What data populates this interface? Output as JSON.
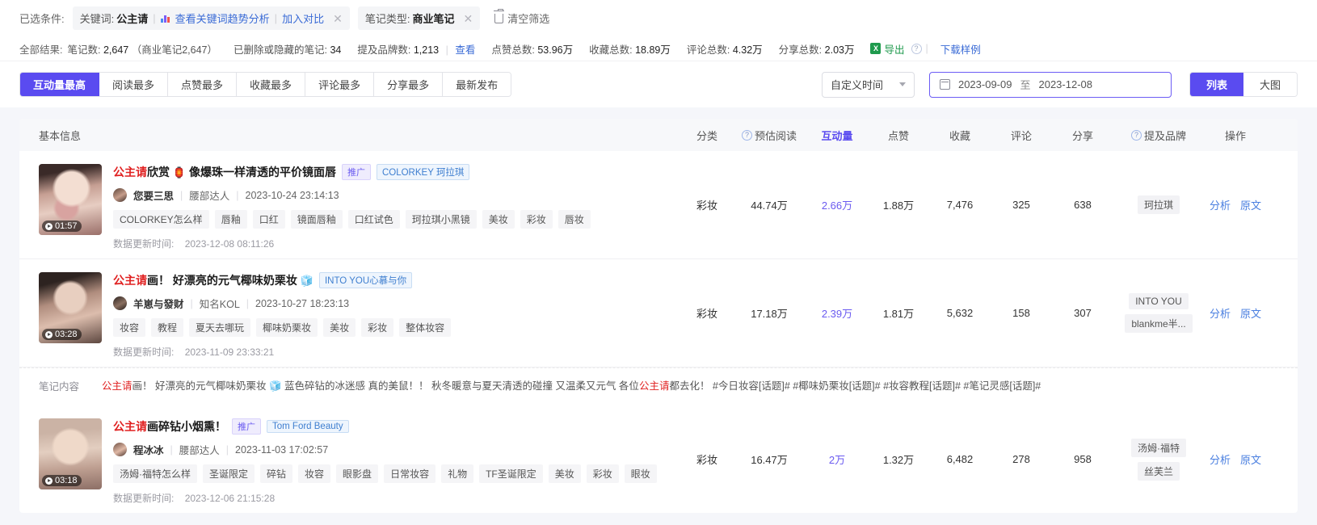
{
  "filters": {
    "label": "已选条件:",
    "chips": [
      {
        "key": "关键词:",
        "value": "公主请",
        "link1": "查看关键词趋势分析",
        "link2": "加入对比",
        "has_chart_icon": true,
        "closable": true
      },
      {
        "key": "笔记类型:",
        "value": "商业笔记",
        "closable": true
      }
    ],
    "clear_label": "清空筛选"
  },
  "stats": {
    "lead": "全部结果:",
    "items": [
      {
        "label": "笔记数:",
        "value": "2,647",
        "extra": "（商业笔记2,647）"
      },
      {
        "label": "已删除或隐藏的笔记:",
        "value": "34"
      },
      {
        "label": "提及品牌数:",
        "value": "1,213",
        "link": "查看"
      },
      {
        "label": "点赞总数:",
        "value": "53.96万"
      },
      {
        "label": "收藏总数:",
        "value": "18.89万"
      },
      {
        "label": "评论总数:",
        "value": "4.32万"
      },
      {
        "label": "分享总数:",
        "value": "2.03万"
      }
    ],
    "export_label": "导出",
    "export_icon_text": "X",
    "download_sample": "下载样例"
  },
  "sort_tabs": [
    {
      "label": "互动量最高",
      "active": true
    },
    {
      "label": "阅读最多",
      "active": false
    },
    {
      "label": "点赞最多",
      "active": false
    },
    {
      "label": "收藏最多",
      "active": false
    },
    {
      "label": "评论最多",
      "active": false
    },
    {
      "label": "分享最多",
      "active": false
    },
    {
      "label": "最新发布",
      "active": false
    }
  ],
  "time_select": {
    "value": "自定义时间"
  },
  "date_range": {
    "start": "2023-09-09",
    "separator": "至",
    "end": "2023-12-08"
  },
  "view_tabs": [
    {
      "label": "列表",
      "active": true
    },
    {
      "label": "大图",
      "active": false
    }
  ],
  "table": {
    "headers": {
      "basic": "基本信息",
      "category": "分类",
      "est_read": "预估阅读",
      "interaction": "互动量",
      "likes": "点赞",
      "favorites": "收藏",
      "comments": "评论",
      "shares": "分享",
      "brands": "提及品牌",
      "actions": "操作"
    },
    "rows": [
      {
        "duration": "01:57",
        "title_highlight": "公主请",
        "title_rest": "欣赏",
        "title_emoji": "🏮",
        "title_tail": "像爆珠一样清透的平价镜面唇",
        "promo_badge": "推广",
        "brand_badge": "COLORKEY 珂拉琪",
        "author": "您要三思",
        "author_type": "腰部达人",
        "published": "2023-10-24 23:14:13",
        "tags": [
          "COLORKEY怎么样",
          "唇釉",
          "口红",
          "镜面唇釉",
          "口红试色",
          "珂拉琪小黑镜",
          "美妆",
          "彩妆",
          "唇妆"
        ],
        "updated_label": "数据更新时间:",
        "updated_value": "2023-12-08 08:11:26",
        "category": "彩妆",
        "est_read": "44.74万",
        "interaction": "2.66万",
        "likes": "1.88万",
        "favorites": "7,476",
        "comments": "325",
        "shares": "638",
        "brands": [
          "珂拉琪"
        ],
        "actions": [
          "分析",
          "原文"
        ]
      },
      {
        "duration": "03:28",
        "title_highlight": "公主请",
        "title_rest": "画！ 好漂亮的元气椰味奶栗妆",
        "title_emoji": "🧊",
        "title_tail": "",
        "promo_badge": "",
        "brand_badge": "INTO YOU心慕与你",
        "author": "羊崽与發财",
        "author_type": "知名KOL",
        "published": "2023-10-27 18:23:13",
        "tags": [
          "妆容",
          "教程",
          "夏天去哪玩",
          "椰味奶栗妆",
          "美妆",
          "彩妆",
          "整体妆容"
        ],
        "updated_label": "数据更新时间:",
        "updated_value": "2023-11-09 23:33:21",
        "category": "彩妆",
        "est_read": "17.18万",
        "interaction": "2.39万",
        "likes": "1.81万",
        "favorites": "5,632",
        "comments": "158",
        "shares": "307",
        "brands": [
          "INTO YOU",
          "blankme半..."
        ],
        "actions": [
          "分析",
          "原文"
        ],
        "content": {
          "label": "笔记内容",
          "parts": [
            {
              "t": "公主请",
              "c": "hl"
            },
            {
              "t": "画！ 好漂亮的元气椰味奶栗妆 ",
              "c": ""
            },
            {
              "t": "🧊",
              "c": "emoji-sq"
            },
            {
              "t": " 蓝色碎钻的冰迷感 真的美鼠！！ 秋冬暖意与夏天清透的碰撞 又温柔又元气 各位",
              "c": ""
            },
            {
              "t": "公主请",
              "c": "hl"
            },
            {
              "t": "都去化！ #今日妆容[话题]# #椰味奶栗妆[话题]# #妆容教程[话题]# #笔记灵感[话题]#",
              "c": ""
            }
          ]
        }
      },
      {
        "duration": "03:18",
        "title_highlight": "公主请",
        "title_rest": "画碎钻小烟熏！",
        "title_emoji": "",
        "title_tail": "",
        "promo_badge": "推广",
        "brand_badge": "Tom Ford Beauty",
        "author": "程冰冰",
        "author_type": "腰部达人",
        "published": "2023-11-03 17:02:57",
        "tags": [
          "汤姆·福特怎么样",
          "圣诞限定",
          "碎钻",
          "妆容",
          "眼影盘",
          "日常妆容",
          "礼物",
          "TF圣诞限定",
          "美妆",
          "彩妆",
          "眼妆"
        ],
        "updated_label": "数据更新时间:",
        "updated_value": "2023-12-06 21:15:28",
        "category": "彩妆",
        "est_read": "16.47万",
        "interaction": "2万",
        "likes": "1.32万",
        "favorites": "6,482",
        "comments": "278",
        "shares": "958",
        "brands": [
          "汤姆·福特",
          "丝芙兰"
        ],
        "actions": [
          "分析",
          "原文"
        ]
      }
    ]
  },
  "colors": {
    "accent": "#5a4bf0",
    "link": "#3a6bd6",
    "highlight": "#e02020",
    "export_green": "#1f9a4d"
  }
}
